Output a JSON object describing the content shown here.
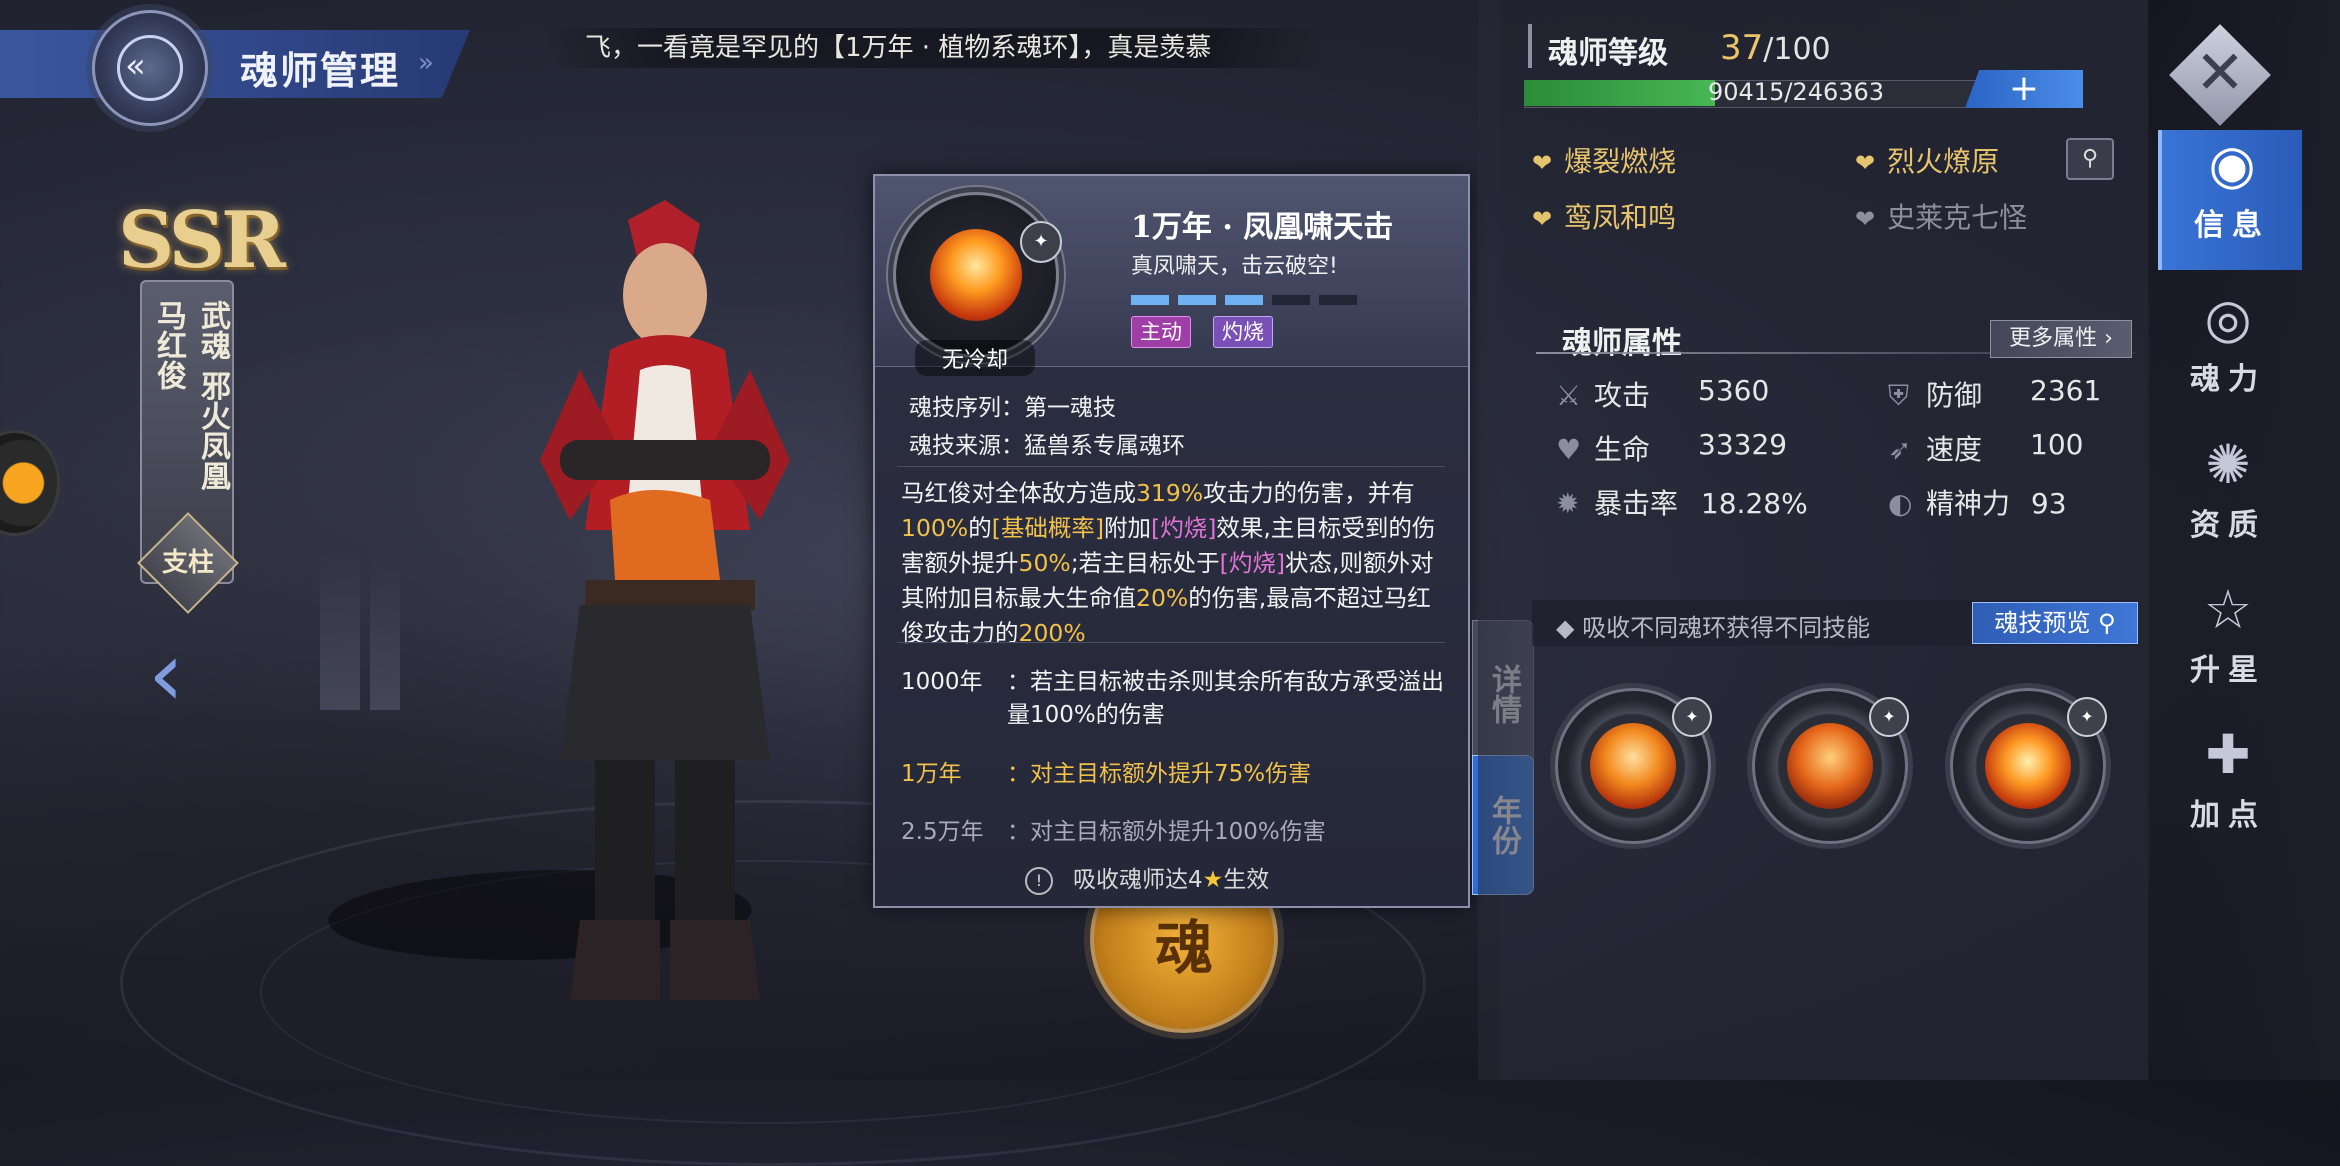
{
  "header": {
    "title": "魂师管理",
    "ticker": "飞，一看竟是罕见的【1万年 · 植物系魂环】，真是羡慕"
  },
  "character": {
    "rarity": "SSR",
    "name": "马红俊",
    "martial_soul": "武魂 邪火凤凰",
    "role": "支柱"
  },
  "bottom_emblem": "魂",
  "skill_popup": {
    "name": "1万年 · 凤凰啸天击",
    "tagline": "真凤啸天，击云破空!",
    "cooldown": "无冷却",
    "level_bars": {
      "filled": 3,
      "total": 5
    },
    "tags": [
      "主动",
      "灼烧"
    ],
    "sequence_label": "魂技序列：",
    "sequence_value": "第一魂技",
    "source_label": "魂技来源：",
    "source_value": "猛兽系专属魂环",
    "desc": {
      "p1": "马红俊对全体敌方造成",
      "v1": "319%",
      "p2": "攻击力的伤害，并有",
      "v2": "100%",
      "p3": "的",
      "k1": "[基础概率]",
      "p4": "附加",
      "k2": "[灼烧]",
      "p5": "效果,主目标受到的伤害额外提升",
      "v3": "50%",
      "p6": ";若主目标处于",
      "k3": "[灼烧]",
      "p7": "状态,则额外对其附加目标最大生命值",
      "v4": "20%",
      "p8": "的伤害,最高不超过马红俊攻击力的",
      "v5": "200%"
    },
    "year_effects": [
      {
        "label": "1000年",
        "text": "：若主目标被击杀则其余所有敌方承受溢出量100%的伤害",
        "state": "active"
      },
      {
        "label": "1万年",
        "text": "：对主目标额外提升75%伤害",
        "state": "current"
      },
      {
        "label": "2.5万年",
        "text": "：对主目标额外提升100%伤害",
        "state": "locked"
      }
    ],
    "unlock_note_pre": "吸收魂师达4",
    "unlock_note_post": "生效",
    "side_tabs": [
      "详情",
      "年份"
    ]
  },
  "level": {
    "label": "魂师等级",
    "current": "37",
    "max": "/100",
    "xp_text": "90415/246363",
    "xp_fraction": 0.367,
    "plus": "+"
  },
  "traits": [
    {
      "label": "爆裂燃烧",
      "active": true
    },
    {
      "label": "烈火燎原",
      "active": true
    },
    {
      "label": "鸾凤和鸣",
      "active": true
    },
    {
      "label": "史莱克七怪",
      "active": false
    }
  ],
  "attributes": {
    "title": "魂师属性",
    "more_button": "更多属性",
    "items": [
      {
        "icon": "sword-icon",
        "label": "攻击",
        "value": "5360"
      },
      {
        "icon": "shield-icon",
        "label": "防御",
        "value": "2361"
      },
      {
        "icon": "heart-icon",
        "label": "生命",
        "value": "33329"
      },
      {
        "icon": "boot-icon",
        "label": "速度",
        "value": "100"
      },
      {
        "icon": "star-burst-icon",
        "label": "暴击率",
        "value": "18.28%"
      },
      {
        "icon": "mind-icon",
        "label": "精神力",
        "value": "93"
      }
    ]
  },
  "soul_rings": {
    "hint": "吸收不同魂环获得不同技能",
    "preview_button": "魂技预览"
  },
  "nav": [
    {
      "icon": "info-icon",
      "label": "信息",
      "active": true
    },
    {
      "icon": "soul-power-icon",
      "label": "魂力",
      "active": false
    },
    {
      "icon": "aptitude-icon",
      "label": "资质",
      "active": false
    },
    {
      "icon": "star-icon",
      "label": "升星",
      "active": false
    },
    {
      "icon": "add-point-icon",
      "label": "加点",
      "active": false
    }
  ],
  "colors": {
    "accent_blue": "#3a74d6",
    "highlight_yellow": "#f2c14a",
    "keyword_pink": "#e073d6",
    "xp_green": "#47b754"
  }
}
